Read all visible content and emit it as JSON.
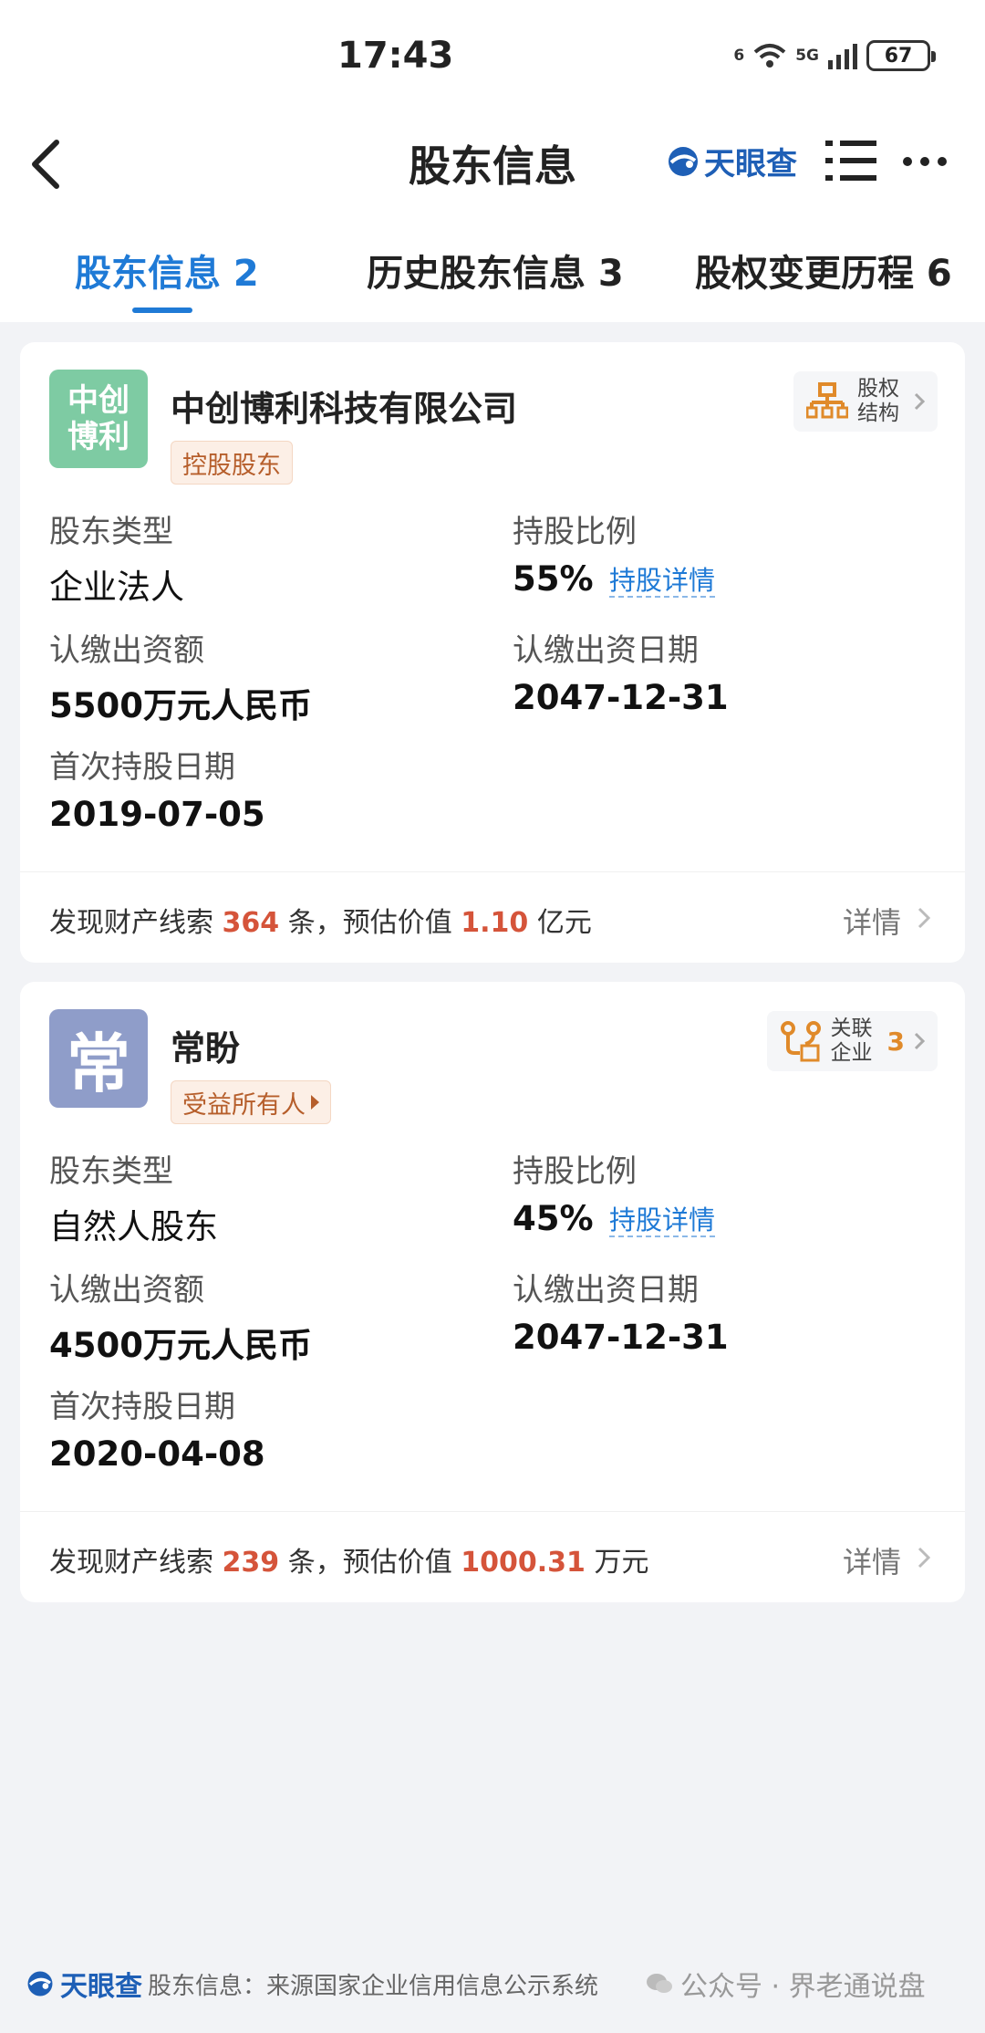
{
  "status_bar": {
    "time": "17:43",
    "net": "6",
    "cell": "5G",
    "battery": "67"
  },
  "header": {
    "title": "股东信息",
    "brand": "天眼查"
  },
  "tabs": [
    {
      "label": "股东信息 2"
    },
    {
      "label": "历史股东信息 3"
    },
    {
      "label": "股权变更历程 6"
    }
  ],
  "shareholders": [
    {
      "index": "1",
      "logo_text": "中创博利",
      "name": "中创博利科技有限公司",
      "tag": "控股股东",
      "side_label": "股权结构",
      "side_count": "",
      "type_label": "股东类型",
      "type_value": "企业法人",
      "ratio_label": "持股比例",
      "ratio_value": "55%",
      "ratio_detail": "持股详情",
      "capital_label": "认缴出资额",
      "capital_value": "5500万元人民币",
      "capital_date_label": "认缴出资日期",
      "capital_date_value": "2047-12-31",
      "first_date_label": "首次持股日期",
      "first_date_value": "2019-07-05",
      "clue_prefix": "发现财产线索",
      "clue_count": "364",
      "clue_mid": "条，预估价值",
      "clue_value": "1.10",
      "clue_unit": "亿元",
      "detail": "详情"
    },
    {
      "index": "2",
      "logo_text": "常",
      "name": "常盼",
      "tag": "受益所有人",
      "side_label": "关联企业",
      "side_count": "3",
      "type_label": "股东类型",
      "type_value": "自然人股东",
      "ratio_label": "持股比例",
      "ratio_value": "45%",
      "ratio_detail": "持股详情",
      "capital_label": "认缴出资额",
      "capital_value": "4500万元人民币",
      "capital_date_label": "认缴出资日期",
      "capital_date_value": "2047-12-31",
      "first_date_label": "首次持股日期",
      "first_date_value": "2020-04-08",
      "clue_prefix": "发现财产线索",
      "clue_count": "239",
      "clue_mid": "条，预估价值",
      "clue_value": "1000.31",
      "clue_unit": "万元",
      "detail": "详情"
    }
  ],
  "source": {
    "brand": "天眼查",
    "text": "股东信息：来源国家企业信用信息公示系统"
  },
  "watermark": "公众号 · 界老通说盘",
  "colors": {
    "accent": "#1f7ad6",
    "highlight": "#d5543a",
    "tag": "#b65e2b",
    "brand": "#1e5fb6"
  }
}
